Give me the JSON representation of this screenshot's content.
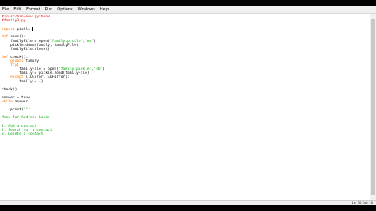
{
  "menu": [
    "File",
    "Edit",
    "Format",
    "Run",
    "Options",
    "Windows",
    "Help"
  ],
  "code": [
    [
      {
        "t": "#!/usr/bin/env python3",
        "c": "cmt"
      }
    ],
    [
      {
        "t": "#family3.py",
        "c": "cmt"
      }
    ],
    [],
    [
      {
        "t": "import",
        "c": "kw"
      },
      {
        "t": " pickle"
      }
    ],
    [],
    [
      {
        "t": "def",
        "c": "kw"
      },
      {
        "t": " save():"
      }
    ],
    [
      {
        "t": "    familyFile = open("
      },
      {
        "t": "\"family.pickle\",\"wb\"",
        "c": "str"
      },
      {
        "t": ")"
      }
    ],
    [
      {
        "t": "    pickle.dump(family, familyFile)"
      }
    ],
    [
      {
        "t": "    familyFile.close()"
      }
    ],
    [],
    [
      {
        "t": "def",
        "c": "kw"
      },
      {
        "t": " check():"
      }
    ],
    [
      {
        "t": "    global",
        "c": "kw"
      },
      {
        "t": " family"
      }
    ],
    [
      {
        "t": "    try",
        "c": "kw"
      },
      {
        "t": ":"
      }
    ],
    [
      {
        "t": "        familyFile = open("
      },
      {
        "t": "\"family.pickle\",\"rb\"",
        "c": "str"
      },
      {
        "t": ")"
      }
    ],
    [
      {
        "t": "        family = pickle.load(familyFile)"
      }
    ],
    [
      {
        "t": "    except",
        "c": "kw"
      },
      {
        "t": " (IOError, EOFError):"
      }
    ],
    [
      {
        "t": "        family = {}"
      }
    ],
    [],
    [
      {
        "t": "check()"
      }
    ],
    [],
    [
      {
        "t": "answer = true"
      }
    ],
    [
      {
        "t": "while",
        "c": "kw"
      },
      {
        "t": " answer:"
      }
    ],
    [],
    [
      {
        "t": "    print("
      },
      {
        "t": "\"\"\"",
        "c": "str"
      }
    ],
    [],
    [
      {
        "t": "Menu for Address-book:",
        "c": "str"
      }
    ],
    [],
    [
      {
        "t": "1. Add a contact",
        "c": "str"
      }
    ],
    [
      {
        "t": "2. Search for a contact",
        "c": "str"
      }
    ],
    [
      {
        "t": "3. Delete a contact",
        "c": "str"
      }
    ]
  ],
  "status": "Ln: 30 Col: 10"
}
